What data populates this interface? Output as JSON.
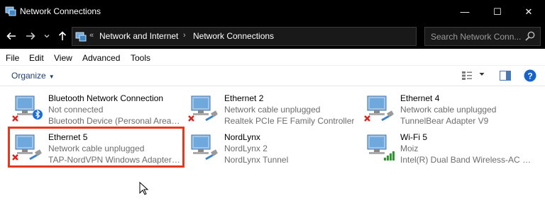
{
  "window": {
    "title": "Network Connections",
    "controls": {
      "minimize": "—",
      "maximize": "☐",
      "close": "✕"
    }
  },
  "address": {
    "overflow": "«",
    "crumbs": [
      "Network and Internet",
      "Network Connections"
    ],
    "separator": "›"
  },
  "search": {
    "placeholder": "Search Network Conn..."
  },
  "menu": [
    "File",
    "Edit",
    "View",
    "Advanced",
    "Tools"
  ],
  "toolbar": {
    "organize": "Organize",
    "caret": "▼"
  },
  "connections": [
    {
      "name": "Bluetooth Network Connection",
      "status": "Not connected",
      "adapter": "Bluetooth Device (Personal Area ...",
      "badge": "bluetooth",
      "disabled": true
    },
    {
      "name": "Ethernet 2",
      "status": "Network cable unplugged",
      "adapter": "Realtek PCIe FE Family Controller",
      "badge": "cable",
      "disabled": true
    },
    {
      "name": "Ethernet 4",
      "status": "Network cable unplugged",
      "adapter": "TunnelBear Adapter V9",
      "badge": "cable",
      "disabled": true
    },
    {
      "name": "Ethernet 5",
      "status": "Network cable unplugged",
      "adapter": "TAP-NordVPN Windows Adapter ...",
      "badge": "cable",
      "disabled": true,
      "highlighted": true
    },
    {
      "name": "NordLynx",
      "status": "NordLynx 2",
      "adapter": "NordLynx Tunnel",
      "badge": "cable",
      "disabled": false
    },
    {
      "name": "Wi-Fi 5",
      "status": "Moiz",
      "adapter": "Intel(R) Dual Band Wireless-AC 31...",
      "badge": "wifi",
      "disabled": false
    }
  ],
  "colors": {
    "highlight": "#e8381c",
    "titlebar": "#000000",
    "disabled_x": "#d9241c",
    "wifi_signal": "#2c9a2c",
    "bluetooth": "#1a6fd6"
  }
}
